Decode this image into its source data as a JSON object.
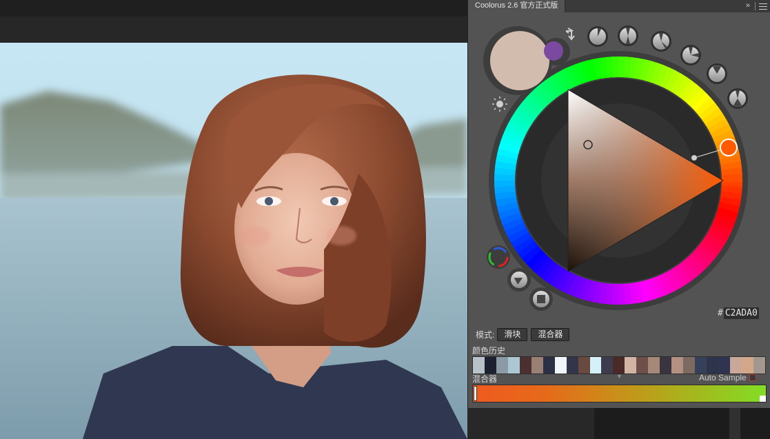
{
  "panel": {
    "title": "Coolorus 2.6 官方正式版",
    "collapse_glyph": "»"
  },
  "picker": {
    "hex_prefix": "#",
    "hex": "C2ADA0",
    "current_color": "#d2bcae",
    "previous_color": "#7b4aa0",
    "hue_color": "#ff5a00"
  },
  "mode": {
    "label": "模式:",
    "slider_button": "滑块",
    "mixer_button": "混合器"
  },
  "history": {
    "label": "颜色历史",
    "swatches": [
      "#b8c3c7",
      "#1e2230",
      "#8c9aa5",
      "#aac7d3",
      "#4c3030",
      "#9a7f75",
      "#2c3044",
      "#f2f6fa",
      "#33354a",
      "#6a4a40",
      "#d4f0f8",
      "#3c3c4c",
      "#4a2a28",
      "#d1b4a3",
      "#6e4f4a",
      "#a58878",
      "#3a3340",
      "#b39081",
      "#7d6a60",
      "#364058",
      "#2e344c",
      "#2f3550",
      "#c9a89a",
      "#d3a78a",
      "#a2988f"
    ]
  },
  "mixer": {
    "label": "混合器",
    "auto_sample": "Auto Sample"
  }
}
